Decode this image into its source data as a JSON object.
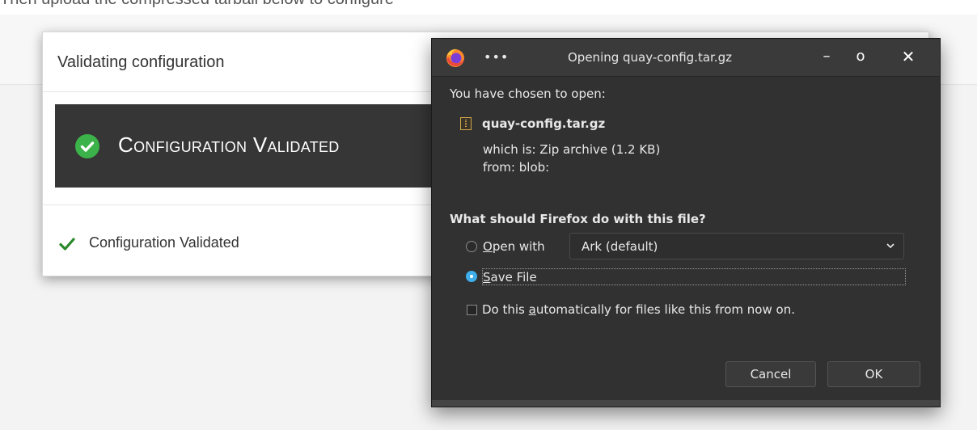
{
  "background": {
    "top_text": "Then upload the compressed tarball below to configure"
  },
  "modal": {
    "title": "Validating configuration",
    "banner_text": "Configuration Validated",
    "status_text": "Configuration Validated",
    "colors": {
      "banner_bg": "#363636",
      "success_green": "#3cb34a",
      "check_green": "#2a8a2a"
    }
  },
  "dialog": {
    "title": "Opening quay-config.tar.gz",
    "menu_label": "•••",
    "window_buttons": {
      "minimize": "–",
      "maximize": "o",
      "close": "✕"
    },
    "chosen_label": "You have chosen to open:",
    "file_name": "quay-config.tar.gz",
    "which_is_label": "which is:",
    "which_is_value": "Zip archive (1.2 KB)",
    "from_label": "from:",
    "from_value": "blob:",
    "question": "What should Firefox do with this file?",
    "open_with": {
      "mnemonic": "O",
      "rest": "pen with",
      "selected": false
    },
    "app_select": {
      "value": "Ark (default)"
    },
    "save_file": {
      "mnemonic": "S",
      "rest": "ave File",
      "selected": true
    },
    "auto": {
      "prefix": "Do this ",
      "mnemonic": "a",
      "rest": "utomatically for files like this from now on.",
      "checked": false
    },
    "buttons": {
      "cancel": "Cancel",
      "ok": "OK"
    },
    "colors": {
      "bg": "#313131",
      "accent": "#3daee9"
    },
    "icons": [
      "firefox-logo-icon",
      "file-archive-icon",
      "chevron-down-icon"
    ]
  }
}
